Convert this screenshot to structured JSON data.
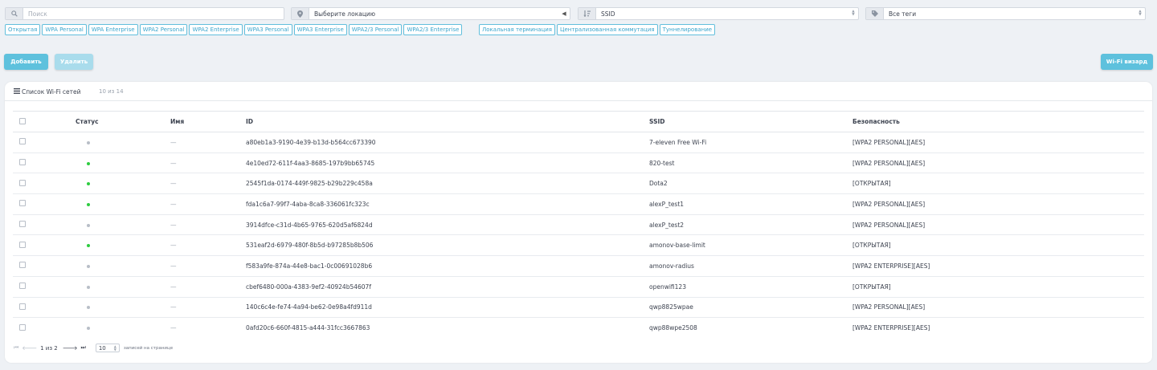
{
  "filters": {
    "search_placeholder": "Поиск",
    "location_value": "Выберите локацию",
    "ssid_value": "SSID",
    "tags_value": "Все теги"
  },
  "security_tags": [
    "Открытая",
    "WPA Personal",
    "WPA Enterprise",
    "WPA2 Personal",
    "WPA2 Enterprise",
    "WPA3 Personal",
    "WPA3 Enterprise",
    "WPA2/3 Personal",
    "WPA2/3 Enterprise"
  ],
  "mode_tags": [
    "Локальная терминация",
    "Централизованная коммутация",
    "Туннелирование"
  ],
  "buttons": {
    "add": "Добавить",
    "delete": "Удалить",
    "wizard": "Wi-Fi визард"
  },
  "list": {
    "title": "Список Wi-Fi сетей",
    "count": "10 из 14"
  },
  "columns": {
    "status": "Статус",
    "name": "Имя",
    "id": "ID",
    "ssid": "SSID",
    "security": "Безопасность"
  },
  "colors": {
    "status_active": "#2ecc40",
    "status_inactive": "#b8bec7",
    "accent": "#5ec1dd"
  },
  "rows": [
    {
      "status": "inactive",
      "name": "—",
      "id": "a80eb1a3-9190-4e39-b13d-b564cc673390",
      "ssid": "7-eleven Free Wi-Fi",
      "security": "[WPA2 PERSONAL][AES]"
    },
    {
      "status": "active",
      "name": "—",
      "id": "4e10ed72-611f-4aa3-8685-197b9bb65745",
      "ssid": "820-test",
      "security": "[WPA2 PERSONAL][AES]"
    },
    {
      "status": "active",
      "name": "—",
      "id": "2545f1da-0174-449f-9825-b29b229c458a",
      "ssid": "Dota2",
      "security": "[ОТКРЫТАЯ]"
    },
    {
      "status": "active",
      "name": "—",
      "id": "fda1c6a7-99f7-4aba-8ca8-336061fc323c",
      "ssid": "alexP_test1",
      "security": "[WPA2 PERSONAL][AES]"
    },
    {
      "status": "inactive",
      "name": "—",
      "id": "3914dfce-c31d-4b65-9765-620d5af6824d",
      "ssid": "alexP_test2",
      "security": "[WPA2 PERSONAL][AES]"
    },
    {
      "status": "active",
      "name": "—",
      "id": "531eaf2d-6979-480f-8b5d-b97285b8b506",
      "ssid": "amonov-base-limit",
      "security": "[ОТКРЫТАЯ]"
    },
    {
      "status": "inactive",
      "name": "—",
      "id": "f583a9fe-874a-44e8-bac1-0c00691028b6",
      "ssid": "amonov-radius",
      "security": "[WPA2 ENTERPRISE][AES]"
    },
    {
      "status": "inactive",
      "name": "—",
      "id": "cbef6480-000a-4383-9ef2-40924b54607f",
      "ssid": "openwifi123",
      "security": "[ОТКРЫТАЯ]"
    },
    {
      "status": "inactive",
      "name": "—",
      "id": "140c6c4e-fe74-4a94-be62-0e98a4fd911d",
      "ssid": "qwp8825wpae",
      "security": "[WPA2 PERSONAL][AES]"
    },
    {
      "status": "inactive",
      "name": "—",
      "id": "0afd20c6-660f-4815-a444-31fcc3667863",
      "ssid": "qwp88wpe2508",
      "security": "[WPA2 ENTERPRISE][AES]"
    }
  ],
  "pagination": {
    "page_info": "1 из 2",
    "per_page": "10",
    "per_page_label": "записей на странице"
  }
}
